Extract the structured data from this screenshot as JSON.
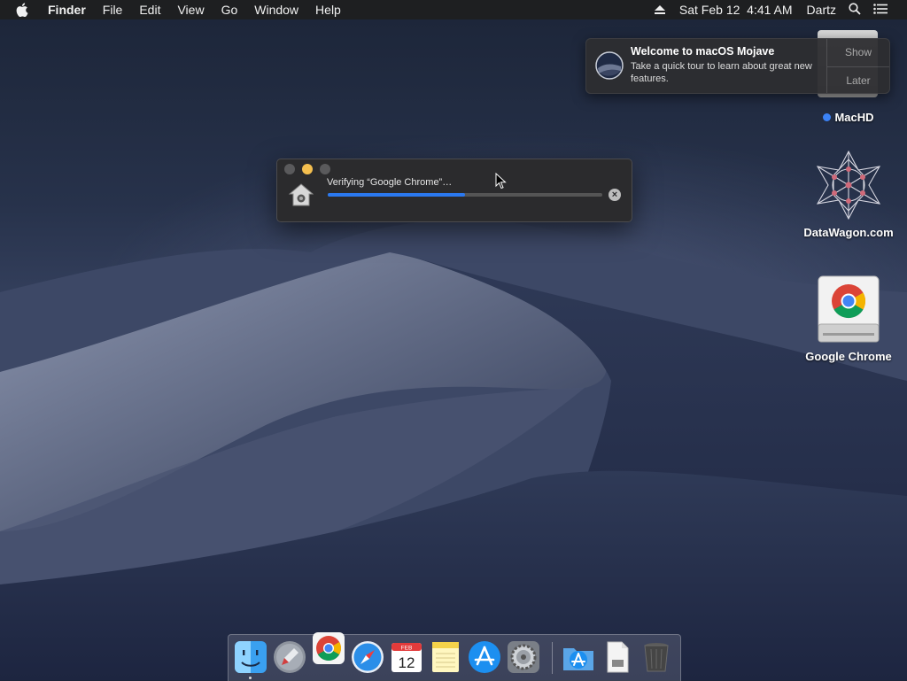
{
  "menubar": {
    "apple_icon": "apple-icon",
    "app_name": "Finder",
    "items": [
      "File",
      "Edit",
      "View",
      "Go",
      "Window",
      "Help"
    ],
    "datetime": "Sat Feb 12  4:41 AM",
    "user": "Dartz",
    "status_icons": [
      "eject-icon",
      "search-icon",
      "list-icon"
    ]
  },
  "notification": {
    "title": "Welcome to macOS Mojave",
    "body": "Take a quick tour to learn about great new features.",
    "show_label": "Show",
    "later_label": "Later"
  },
  "desktop_icons": [
    {
      "label": "MacHD",
      "tag_color": "#3b82f6"
    },
    {
      "label": "DataWagon.com"
    },
    {
      "label": "Google Chrome"
    }
  ],
  "progress_window": {
    "label": "Verifying “Google Chrome”…",
    "progress_fraction": 0.5
  },
  "dock": {
    "apps": [
      "Finder",
      "Launchpad",
      "Google Chrome",
      "Safari",
      "Calendar",
      "Notes",
      "App Store",
      "System Preferences",
      "Applications",
      "Documents",
      "Trash"
    ],
    "calendar_month": "FEB",
    "calendar_day": "12"
  },
  "colors": {
    "accent": "#2b79f0",
    "traffic_yellow": "#f4bf4f"
  }
}
